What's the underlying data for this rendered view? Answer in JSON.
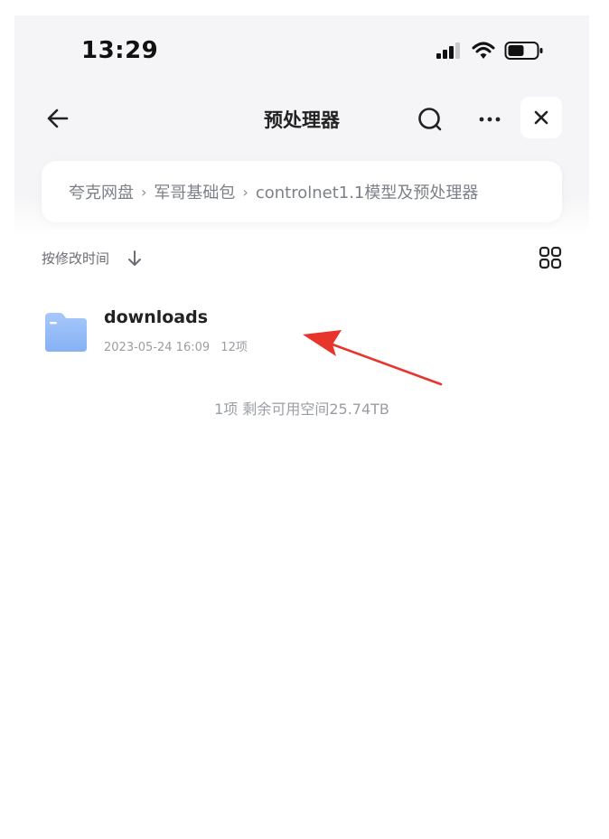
{
  "status_bar": {
    "time": "13:29"
  },
  "nav": {
    "title": "预处理器"
  },
  "breadcrumb": {
    "items": [
      "夸克网盘",
      "军哥基础包",
      "controlnet1.1模型及预处理器"
    ],
    "separator": "›"
  },
  "sort": {
    "label": "按修改时间"
  },
  "files": [
    {
      "name": "downloads",
      "modified": "2023-05-24 16:09",
      "count": "12项"
    }
  ],
  "footer": {
    "summary": "1项 剩余可用空间25.74TB"
  },
  "colors": {
    "folder": "#8fb8f7",
    "annotation_arrow": "#e8352c",
    "background": "#f5f5f7"
  },
  "icons": {
    "back": "arrow-left",
    "search": "search",
    "more": "more-horizontal",
    "close": "close",
    "sort": "arrow-down",
    "view": "grid",
    "file": "folder",
    "signal": "cellular-signal",
    "wifi": "wifi",
    "battery": "battery"
  }
}
